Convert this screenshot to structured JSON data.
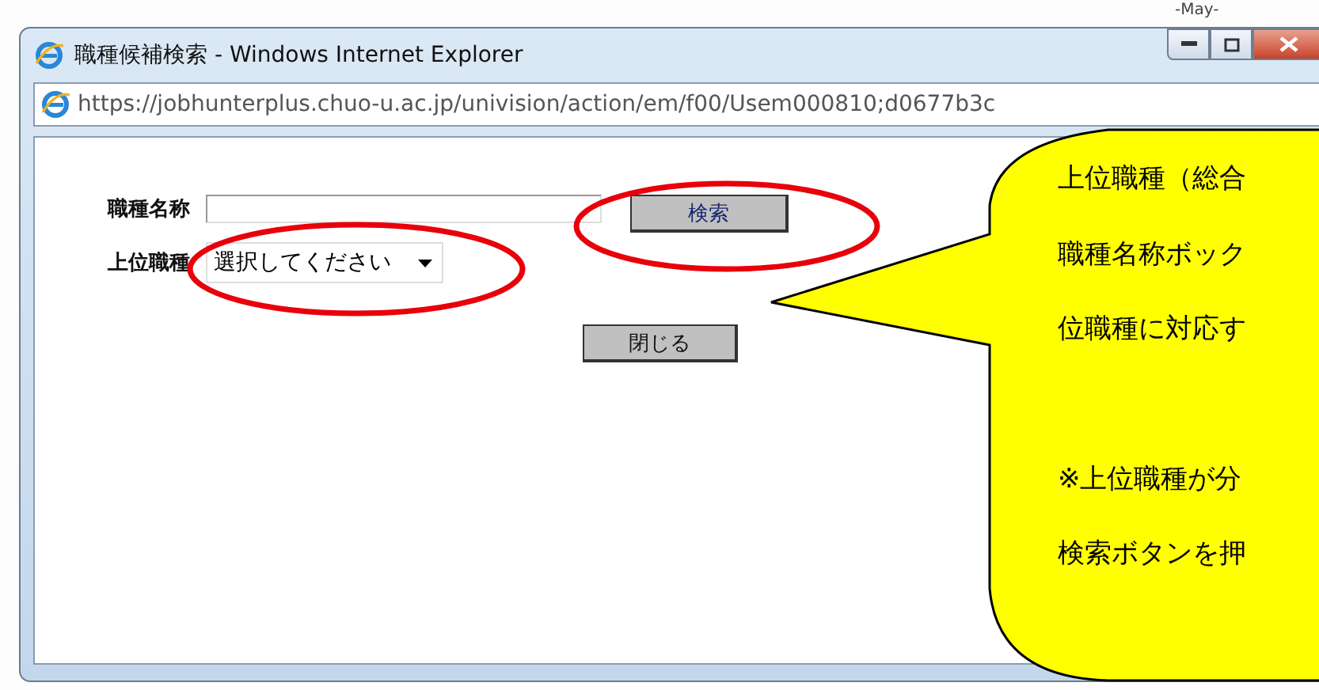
{
  "desktop": {
    "background_text": "-May-"
  },
  "window": {
    "title": "職種候補検索 - Windows Internet Explorer"
  },
  "address_bar": {
    "url": "https://jobhunterplus.chuo-u.ac.jp/univision/action/em/f00/Usem000810;d0677b3c"
  },
  "form": {
    "fields": [
      {
        "kind": "text",
        "label": "職種名称"
      },
      {
        "kind": "select",
        "label": "上位職種",
        "value": "選択してください"
      }
    ],
    "search_button": "検索",
    "close_button": "閉じる"
  },
  "annotation": {
    "paragraphs": [
      [
        "上位職種（総合",
        "職種名称ボック",
        "位職種に対応す"
      ],
      [
        "※上位職種が分",
        "検索ボタンを押"
      ]
    ]
  }
}
